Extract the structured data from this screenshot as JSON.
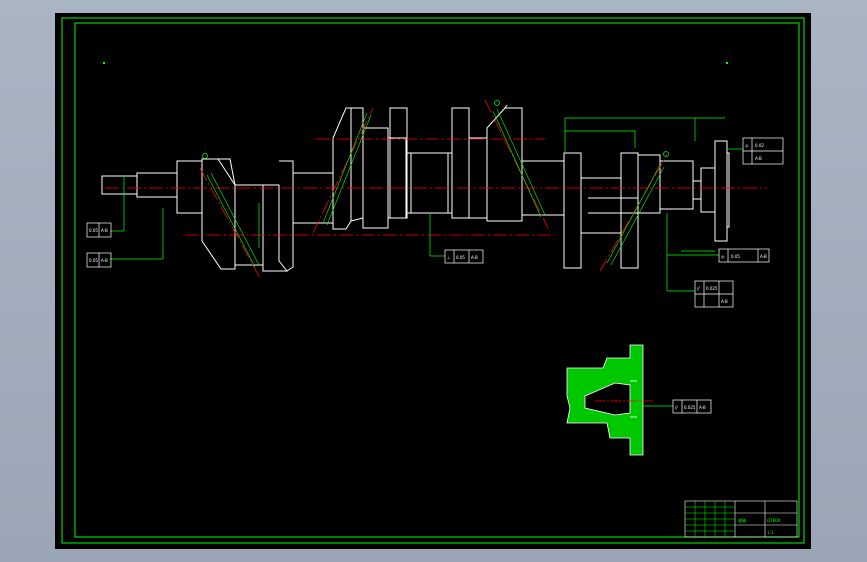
{
  "colors": {
    "background": "#000000",
    "frame": "#00ff00",
    "outline": "#ffffff",
    "centerline": "#ff0000",
    "hatch": "#00ff00",
    "dimension": "#00ff00"
  },
  "callouts": {
    "left_upper": {
      "symbol": "",
      "value": "0.05",
      "datum": "A-B"
    },
    "left_lower": {
      "symbol": "",
      "value": "0.05",
      "datum": "A-B"
    },
    "center": {
      "symbol": "⊥",
      "value": "0.05",
      "datum": "A-B"
    },
    "right_top": {
      "symbol": "◎",
      "value": "0.02",
      "datum": "A-B"
    },
    "right_mid": {
      "symbol": "◎",
      "value": "0.05",
      "datum": "A-B"
    },
    "right_lower": {
      "symbol": "//",
      "value": "0.025",
      "datum": "A-B"
    },
    "section": {
      "symbol": "//",
      "value": "0.025",
      "datum": "A-B"
    }
  },
  "title_block": {
    "drawing_name": "曲轴",
    "material": "QT600",
    "scale": "1:1"
  }
}
